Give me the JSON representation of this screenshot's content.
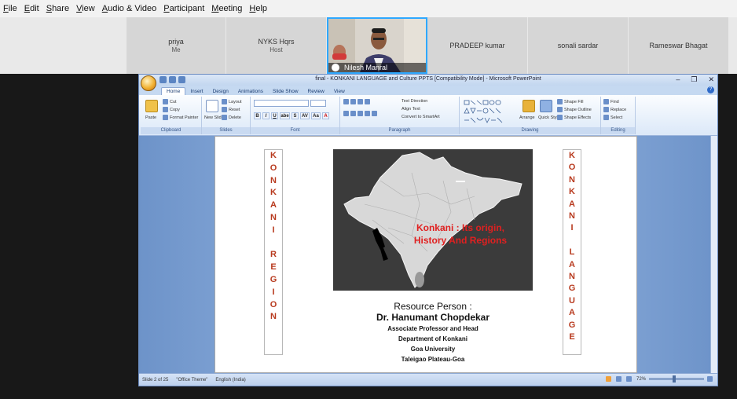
{
  "menubar": {
    "items": [
      {
        "key": "F",
        "rest": "ile"
      },
      {
        "key": "E",
        "rest": "dit"
      },
      {
        "key": "S",
        "rest": "hare"
      },
      {
        "key": "V",
        "rest": "iew"
      },
      {
        "key": "A",
        "rest": "udio & Video"
      },
      {
        "key": "P",
        "rest": "articipant"
      },
      {
        "key": "M",
        "rest": "eeting"
      },
      {
        "key": "H",
        "rest": "elp"
      }
    ]
  },
  "participants": [
    {
      "name": "priya",
      "sub": "Me"
    },
    {
      "name": "NYKS Hqrs",
      "sub": "Host"
    },
    {
      "name": "Nilesh Manral",
      "sub": ""
    },
    {
      "name": "PRADEEP kumar",
      "sub": ""
    },
    {
      "name": "sonali sardar",
      "sub": ""
    },
    {
      "name": "Rameswar Bhagat",
      "sub": ""
    }
  ],
  "ppt": {
    "title": "final - KONKANI LANGUAGE and Culture PPTS [Compatibility Mode] - Microsoft PowerPoint",
    "tabs": [
      "Home",
      "Insert",
      "Design",
      "Animations",
      "Slide Show",
      "Review",
      "View"
    ],
    "ribbon": {
      "clipboard": {
        "label": "Clipboard",
        "paste": "Paste",
        "cut": "Cut",
        "copy": "Copy",
        "format_painter": "Format Painter"
      },
      "slides": {
        "label": "Slides",
        "new_slide": "New Slide",
        "layout": "Layout",
        "reset": "Reset",
        "delete": "Delete"
      },
      "font": {
        "label": "Font",
        "bold": "B",
        "italic": "I",
        "underline": "U",
        "strike": "abe",
        "shadow": "S",
        "spacing": "AV",
        "case": "Aa",
        "color": "A"
      },
      "paragraph": {
        "label": "Paragraph",
        "text_direction": "Text Direction",
        "align_text": "Align Text",
        "smartart": "Convert to SmartArt"
      },
      "drawing": {
        "label": "Drawing",
        "arrange": "Arrange",
        "quick_styles": "Quick Styles",
        "shape_fill": "Shape Fill",
        "shape_outline": "Shape Outline",
        "shape_effects": "Shape Effects"
      },
      "editing": {
        "label": "Editing",
        "find": "Find",
        "replace": "Replace",
        "select": "Select"
      }
    },
    "slide": {
      "left_letters": [
        "K",
        "O",
        "N",
        "K",
        "A",
        "N",
        "I",
        "",
        "R",
        "E",
        "G",
        "I",
        "O",
        "N"
      ],
      "right_letters": [
        "K",
        "O",
        "N",
        "K",
        "A",
        "N",
        "I",
        "",
        "L",
        "A",
        "N",
        "G",
        "U",
        "A",
        "G",
        "E"
      ],
      "map_title_1": "Konkani : Its  origin,",
      "map_title_2": "History And  Regions",
      "resource": "Resource Person :",
      "name": "Dr. Hanumant  Chopdekar",
      "lines": [
        "Associate Professor and Head",
        "Department of Konkani",
        "Goa University",
        "Taleigao Plateau-Goa"
      ]
    },
    "status": {
      "slide": "Slide 2 of 25",
      "theme": "\"Office Theme\"",
      "lang": "English (India)",
      "zoom": "72%"
    }
  },
  "colors": {
    "accent": "#2ea8ff",
    "slide_text": "#b83a1e",
    "map_title": "#e02020"
  }
}
